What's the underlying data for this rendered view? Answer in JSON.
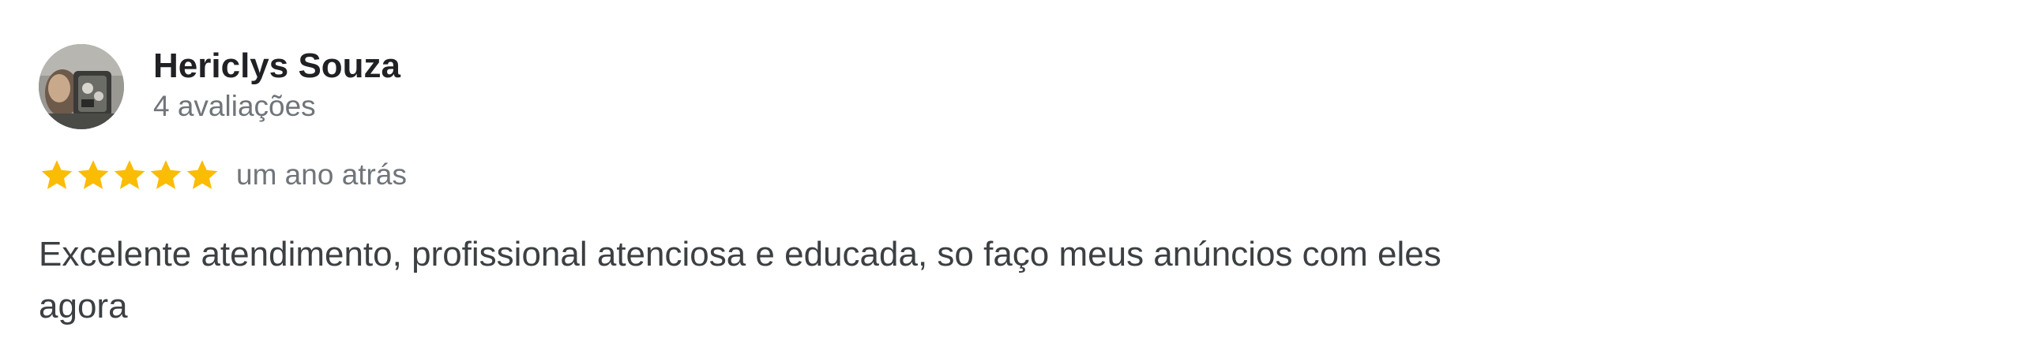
{
  "reviewer": {
    "name": "Hericlys Souza",
    "reviews_count": "4 avaliações",
    "avatar_icon": "user-avatar-photo"
  },
  "rating": {
    "stars": 5,
    "max_stars": 5,
    "star_color": "#fbbc04",
    "star_icon": "star-icon"
  },
  "review": {
    "date": "um ano atrás",
    "text_line1": "Excelente atendimento, profissional atenciosa e educada, so faço meus anúncios com eles",
    "text_line2": "agora"
  }
}
